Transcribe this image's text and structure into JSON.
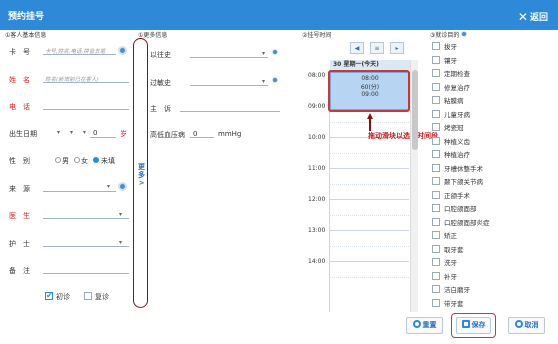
{
  "window": {
    "title": "预约挂号",
    "back_label": "返回"
  },
  "basic": {
    "section_title": "①客人基本信息",
    "card_label": "卡　号",
    "card_placeholder": "卡号,姓名,电话,拼音五笔",
    "name_label": "姓　名",
    "name_placeholder": "姓名(新增前已在客人)",
    "phone_label": "电　话",
    "birth_label": "出生日期",
    "birth_year": "▾",
    "birth_month": "▾",
    "birth_day": "▾",
    "age_value": "0",
    "age_unit": "岁",
    "gender_label": "性　别",
    "gender_male": "男",
    "gender_female": "女",
    "gender_unknown": "未填",
    "gender_selected": "未填",
    "source_label": "来　源",
    "doctor_label": "医　生",
    "nurse_label": "护　士",
    "note_label": "备　注",
    "first_visit_label": "初诊",
    "first_visit_checked": true,
    "revisit_label": "复诊",
    "revisit_checked": false
  },
  "more_toggle": {
    "label_top": "更",
    "label_bottom": "多",
    "arrow": ">"
  },
  "more": {
    "section_title": "①更多信息",
    "history_label": "以往史",
    "allergy_label": "过敏史",
    "complaint_label": "主　诉",
    "bp_label": "高低血压病",
    "bp_value": "0",
    "bp_unit": "mmHg"
  },
  "schedule": {
    "section_title": "②挂号时间",
    "nav_prev": "◀",
    "nav_list": "≡",
    "nav_next": "▸",
    "day_header": "30 星期一(今天)",
    "hours": [
      "08:00",
      "09:00",
      "10:00",
      "11:00",
      "12:00",
      "13:00",
      "14:00"
    ],
    "event_start": "08:00",
    "event_duration": "60(分)",
    "event_end": "09:00",
    "annotation": "拖动滑块以选择时间段"
  },
  "purpose": {
    "section_title": "③就诊目的",
    "items": [
      {
        "label": "拔牙",
        "checked": false
      },
      {
        "label": "镶牙",
        "checked": false
      },
      {
        "label": "定期检查",
        "checked": false
      },
      {
        "label": "修复治疗",
        "checked": false
      },
      {
        "label": "粘膜病",
        "checked": false
      },
      {
        "label": "儿童牙病",
        "checked": false
      },
      {
        "label": "烤瓷冠",
        "checked": false
      },
      {
        "label": "种植义齿",
        "checked": false
      },
      {
        "label": "种植治疗",
        "checked": false
      },
      {
        "label": "牙槽休整手术",
        "checked": false
      },
      {
        "label": "颞下颌关节病",
        "checked": false
      },
      {
        "label": "正颌手术",
        "checked": false
      },
      {
        "label": "口腔颌面部",
        "checked": false
      },
      {
        "label": "口腔颌面部炎症",
        "checked": false
      },
      {
        "label": "矫正",
        "checked": false
      },
      {
        "label": "取牙套",
        "checked": false
      },
      {
        "label": "洗牙",
        "checked": false
      },
      {
        "label": "补牙",
        "checked": false
      },
      {
        "label": "洁白磨牙",
        "checked": false
      },
      {
        "label": "带牙套",
        "checked": false
      }
    ]
  },
  "footer": {
    "reset_label": "重置",
    "save_label": "保存",
    "cancel_label": "取消"
  }
}
